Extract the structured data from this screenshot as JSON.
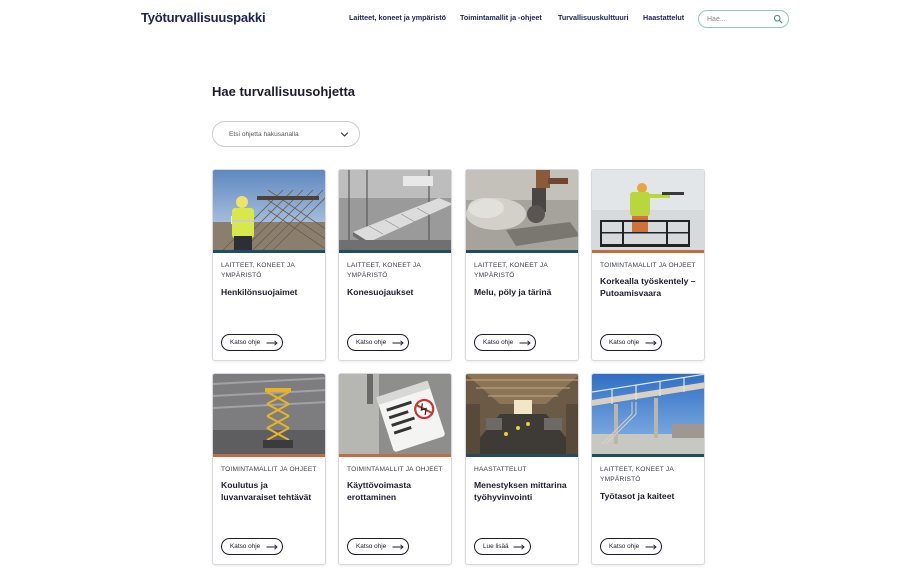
{
  "header": {
    "logo": "Työturvallisuuspakki",
    "nav": [
      {
        "label": "Laitteet, koneet ja ympäristö"
      },
      {
        "label": "Toimintamallit ja -ohjeet"
      },
      {
        "label": "Turvallisuuskulttuuri"
      },
      {
        "label": "Haastattelut"
      }
    ],
    "search_placeholder": "Hae..."
  },
  "main": {
    "title": "Hae turvallisuusohjetta",
    "dropdown_text": "Etsi ohjetta hakusanalla"
  },
  "cards": [
    {
      "category": "Laitteet, koneet ja ympäristö",
      "title": "Henkilönsuojaimet",
      "button": "Katso ohje",
      "stripe": "#1f4e63",
      "image": "worker-rebar-construction-site"
    },
    {
      "category": "Laitteet, koneet ja ympäristö",
      "title": "Konesuojaukset",
      "button": "Katso ohje",
      "stripe": "#1f4e63",
      "image": "conveyor-machinery"
    },
    {
      "category": "Laitteet, koneet ja ympäristö",
      "title": "Melu, pöly ja tärinä",
      "button": "Katso ohje",
      "stripe": "#1f4e63",
      "image": "concrete-cutting-dust"
    },
    {
      "category": "Toimintamallit ja ohjeet",
      "title": "Korkealla työskentely – Putoamisvaara",
      "button": "Katso ohje",
      "stripe": "#c86a3a",
      "image": "worker-aerial-lift"
    },
    {
      "category": "Toimintamallit ja ohjeet",
      "title": "Koulutus ja luvanvaraiset tehtävät",
      "button": "Katso ohje",
      "stripe": "#c86a3a",
      "image": "scissor-lift-warehouse"
    },
    {
      "category": "Toimintamallit ja ohjeet",
      "title": "Käyttövoimasta erottaminen",
      "button": "Katso ohje",
      "stripe": "#c86a3a",
      "image": "lockout-tag-sign"
    },
    {
      "category": "Haastattelut",
      "title": "Menestyksen mittarina työhyvinvointi",
      "button": "Lue lisää",
      "stripe": "#1f4e63",
      "image": "factory-hall"
    },
    {
      "category": "Laitteet, koneet ja ympäristö",
      "title": "Työtasot ja kaiteet",
      "button": "Katso ohje",
      "stripe": "#1f4e63",
      "image": "walkway-railings"
    }
  ]
}
